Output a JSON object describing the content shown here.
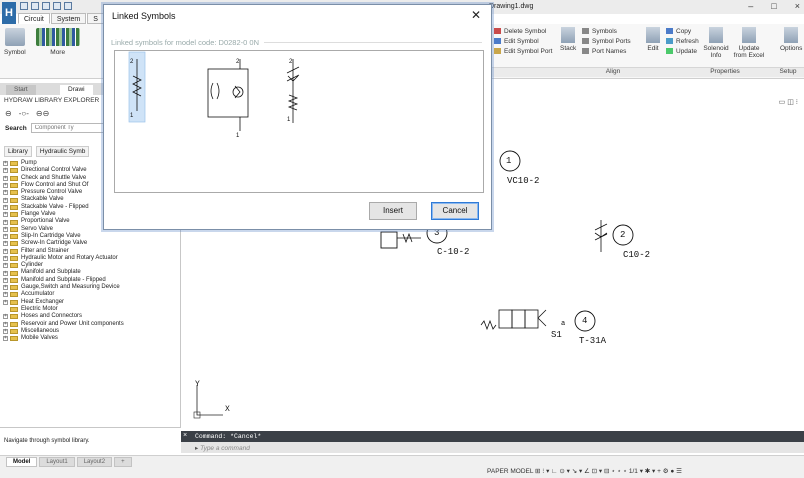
{
  "window": {
    "logo": "H",
    "doc_title": "Drawing1.dwg",
    "minimize": "–",
    "maximize": "□",
    "close": "×"
  },
  "ribbon": {
    "tabs": [
      "Circuit",
      "System",
      "S"
    ],
    "left_buttons": [
      {
        "label": "Symbol",
        "icon": "symbol-icon"
      },
      {
        "label": "More",
        "icon": "more-icon"
      }
    ],
    "symbol_group": [
      "Delete Symbol",
      "Edit Symbol",
      "Edit Symbol Port"
    ],
    "stack_label": "Stack",
    "ports_group": [
      "Symbols",
      "Symbol Ports",
      "Port Names"
    ],
    "align_label": "Align",
    "edit_label": "Edit",
    "props_group": [
      "Copy",
      "Refresh",
      "Update"
    ],
    "solenoid_info": "Solenoid Info",
    "update_from_excel": "Update from Excel",
    "properties_label": "Properties",
    "options_label": "Options",
    "setup_label": "Setup"
  },
  "doc_tabs": {
    "start": "Start",
    "drawing": "Drawi"
  },
  "palette": {
    "title": "HYDRAW LIBRARY EXPLORER",
    "search_label": "Search",
    "search_placeholder": "Component Ty",
    "lib_tabs": [
      "Library",
      "Hydraulic Symb"
    ],
    "tree": [
      "Pump",
      "Directional Control Valve",
      "Check and Shuttle Valve",
      "Flow Control and Shut Of",
      "Pressure Control Valve",
      "Stackable Valve",
      "Stackable Valve - Flipped",
      "Flange Valve",
      "Proportional Valve",
      "Servo Valve",
      "Slip-In Cartridge Valve",
      "Screw-In Cartridge Valve",
      "Filter and Strainer",
      "Hydraulic Motor and Rotary Actuator",
      "Cylinder",
      "Manifold and Subplate",
      "Manifold and Subplate - Flipped",
      "Gauge,Switch and Measuring Device",
      "Accumulator",
      "Heat Exchanger",
      "Electric Motor",
      "Hoses and Connectors",
      "Reservoir and Power Unit components",
      "Miscellaneous",
      "Mobile Valves"
    ],
    "status": "Navigate through symbol library."
  },
  "dialog": {
    "title": "Linked Symbols",
    "group_caption": "Linked symbols for model code: D0282-0 0N",
    "insert": "Insert",
    "cancel": "Cancel"
  },
  "canvas": {
    "labels": {
      "n1": "1",
      "vc": "VC10-2",
      "n3": "3",
      "c10": "C-10-2",
      "n2": "2",
      "c102": "C10-2",
      "n4": "4",
      "s1": "S1",
      "a": "a",
      "t31": "T-31A"
    },
    "axis_y": "Y",
    "axis_x": "X"
  },
  "command": {
    "history": "Command: *Cancel*",
    "placeholder": "Type a command"
  },
  "layout_tabs": [
    "Model",
    "Layout1",
    "Layout2",
    "+"
  ],
  "status_bar": "PAPER MODEL"
}
